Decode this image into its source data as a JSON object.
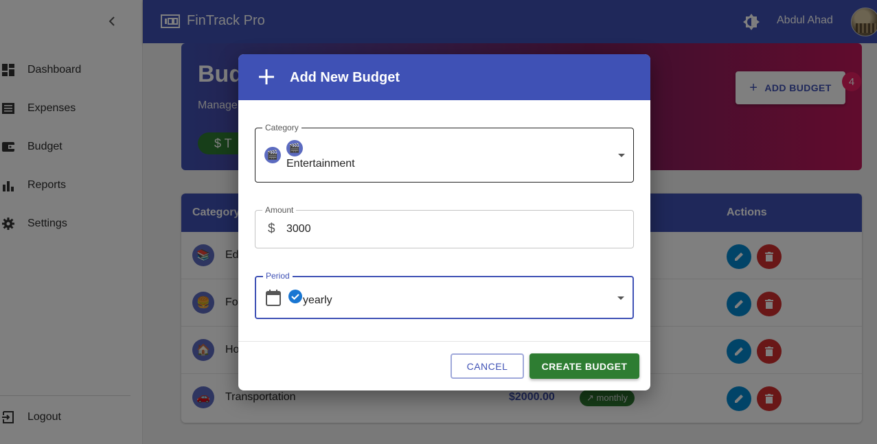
{
  "app": {
    "title": "FinTrack Pro",
    "user_name": "Abdul Ahad"
  },
  "sidebar": {
    "items": [
      {
        "label": "Dashboard",
        "icon": "dashboard-icon"
      },
      {
        "label": "Expenses",
        "icon": "receipt-icon"
      },
      {
        "label": "Budget",
        "icon": "wallet-icon"
      },
      {
        "label": "Reports",
        "icon": "bar-chart-icon"
      },
      {
        "label": "Settings",
        "icon": "gear-icon"
      }
    ],
    "logout_label": "Logout"
  },
  "page": {
    "title": "Bud",
    "subtitle": "Manage",
    "chip_label": "$  T",
    "add_budget_label": "ADD BUDGET",
    "badge_count": "4"
  },
  "table": {
    "headers": {
      "category": "Category",
      "actions": "Actions"
    },
    "rows": [
      {
        "name": "Ed",
        "icon": "📚",
        "amount": "",
        "period": ""
      },
      {
        "name": "Fo",
        "icon": "🍔",
        "amount": "",
        "period": ""
      },
      {
        "name": "Ho",
        "icon": "🏠",
        "amount": "",
        "period": ""
      },
      {
        "name": "Transportation",
        "icon": "🚗",
        "amount": "$2000.00",
        "period": "monthly"
      }
    ]
  },
  "dialog": {
    "title": "Add New Budget",
    "category_label": "Category",
    "category_value": "Entertainment",
    "category_icon": "🎬",
    "amount_label": "Amount",
    "amount_value": "3000",
    "amount_prefix": "$",
    "period_label": "Period",
    "period_value": "yearly",
    "cancel_label": "CANCEL",
    "create_label": "CREATE BUDGET"
  },
  "colors": {
    "primary": "#3f51b5",
    "success": "#2e7d32",
    "danger": "#d32f2f",
    "info": "#0288d1",
    "badge": "#e91e63"
  }
}
